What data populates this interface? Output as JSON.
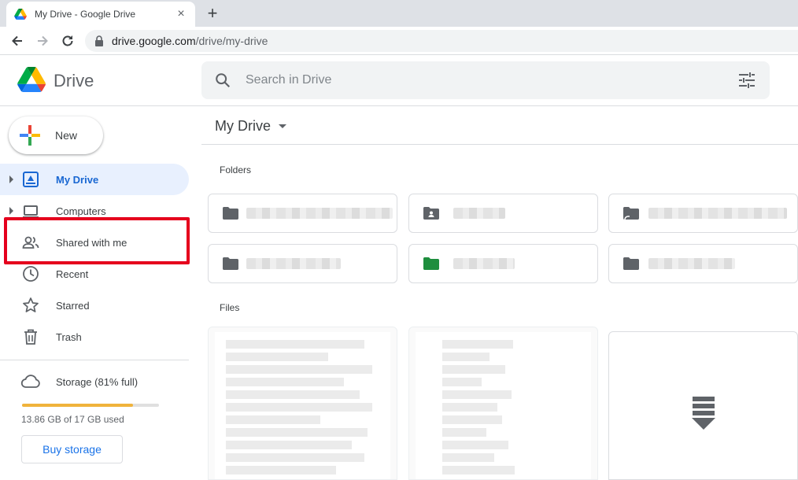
{
  "browser": {
    "tab_title": "My Drive - Google Drive",
    "tab_close": "×",
    "new_tab": "+",
    "url_domain": "drive.google.com",
    "url_path": "/drive/my-drive"
  },
  "header": {
    "product_name": "Drive",
    "search_placeholder": "Search in Drive"
  },
  "sidebar": {
    "new_label": "New",
    "items": [
      {
        "label": "My Drive",
        "icon": "my-drive-icon",
        "active": true,
        "expandable": true
      },
      {
        "label": "Computers",
        "icon": "computers-icon",
        "active": false,
        "expandable": true
      },
      {
        "label": "Shared with me",
        "icon": "shared-icon",
        "active": false,
        "expandable": false
      },
      {
        "label": "Recent",
        "icon": "clock-icon",
        "active": false,
        "expandable": false
      },
      {
        "label": "Starred",
        "icon": "star-icon",
        "active": false,
        "expandable": false
      },
      {
        "label": "Trash",
        "icon": "trash-icon",
        "active": false,
        "expandable": false
      }
    ],
    "storage": {
      "label": "Storage (81% full)",
      "used_fraction": 0.81,
      "used_text": "13.86 GB of 17 GB used",
      "buy_label": "Buy storage"
    }
  },
  "main": {
    "breadcrumb": "My Drive",
    "folders_title": "Folders",
    "files_title": "Files"
  },
  "colors": {
    "accent": "#1a73e8",
    "active_bg": "#e8f0fe",
    "highlight": "#e5001d",
    "storage_fill": "#f0b33c",
    "green_folder": "#1e8e3e"
  }
}
